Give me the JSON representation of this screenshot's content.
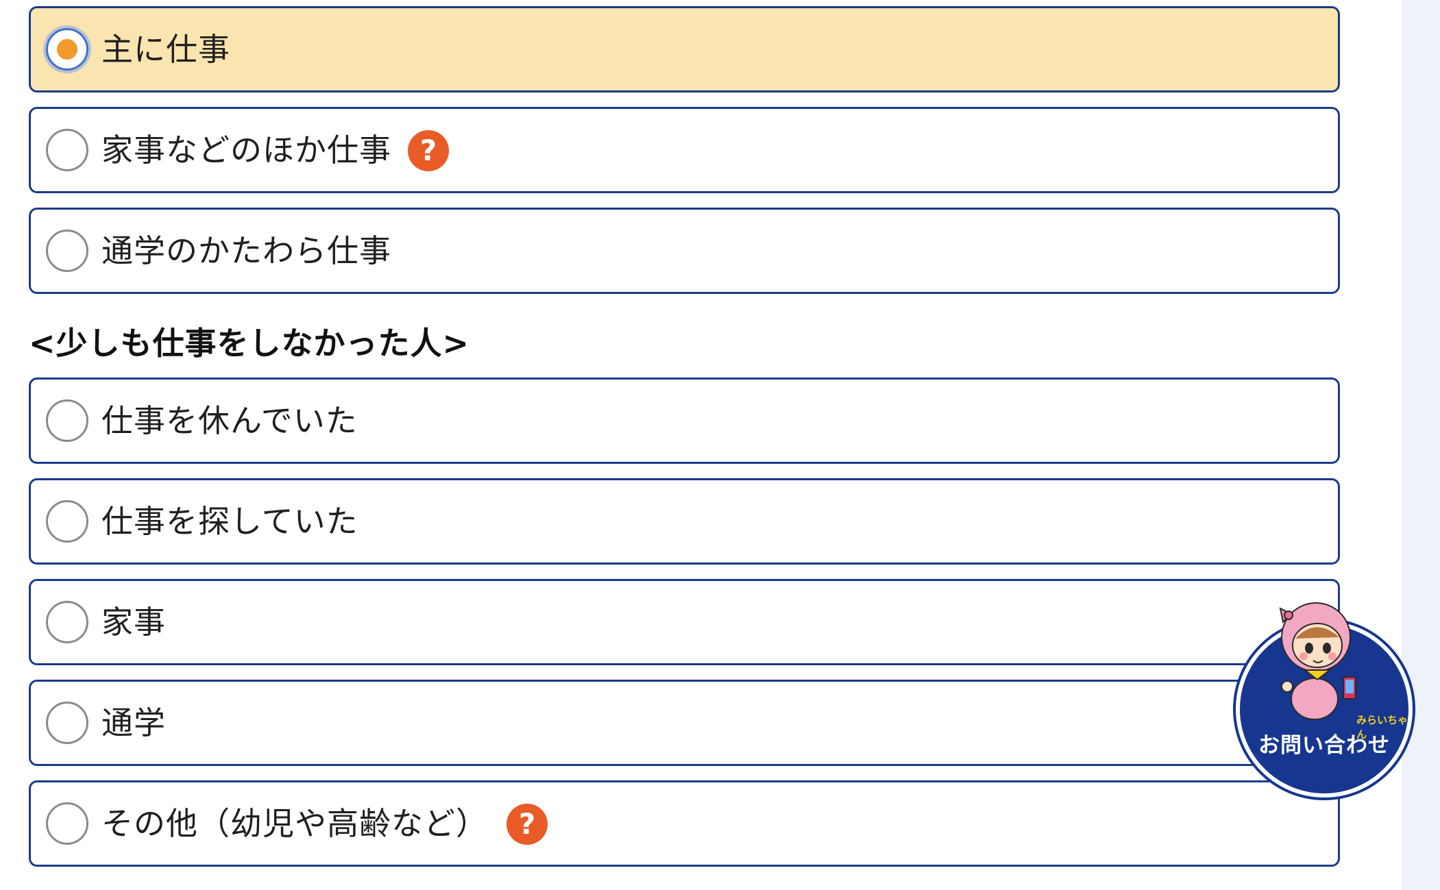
{
  "options_group_1": [
    {
      "label": "主に仕事",
      "selected": true,
      "has_help": false
    },
    {
      "label": "家事などのほか仕事",
      "selected": false,
      "has_help": true
    },
    {
      "label": "通学のかたわら仕事",
      "selected": false,
      "has_help": false
    }
  ],
  "section_heading": "<少しも仕事をしなかった人>",
  "options_group_2": [
    {
      "label": "仕事を休んでいた",
      "selected": false,
      "has_help": false
    },
    {
      "label": "仕事を探していた",
      "selected": false,
      "has_help": false
    },
    {
      "label": "家事",
      "selected": false,
      "has_help": false
    },
    {
      "label": "通学",
      "selected": false,
      "has_help": false
    },
    {
      "label": "その他（幼児や高齢など）",
      "selected": false,
      "has_help": true
    }
  ],
  "help_icon_text": "?",
  "contact": {
    "label": "お問い合わせ",
    "mascot_name": "みらいちゃん",
    "icon": "mascot-character"
  },
  "colors": {
    "border": "#1b3a8c",
    "selected_bg": "#fae5b0",
    "radio_selected_dot": "#f29a2e",
    "help_icon": "#e95b27",
    "contact_bg": "#16368f"
  }
}
